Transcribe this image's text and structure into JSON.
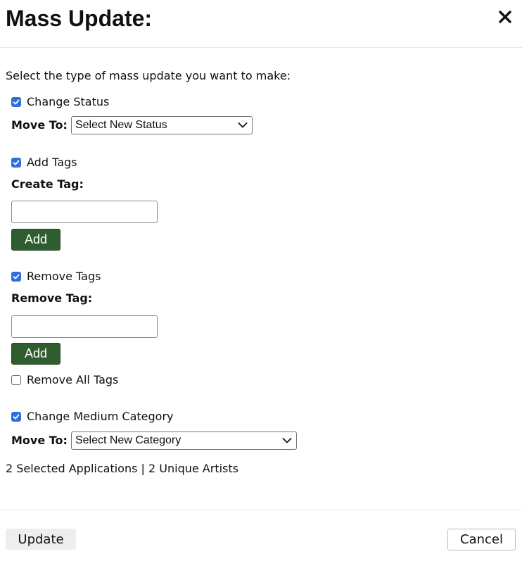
{
  "dialog": {
    "title": "Mass Update:",
    "close_icon": "close-icon",
    "intro": "Select the type of mass update you want to make:"
  },
  "change_status": {
    "checked": true,
    "label": "Change Status",
    "move_to_label": "Move To:",
    "select_value": "Select New Status"
  },
  "add_tags": {
    "checked": true,
    "label": "Add Tags",
    "field_label": "Create Tag:",
    "input_value": "",
    "button_label": "Add"
  },
  "remove_tags": {
    "checked": true,
    "label": "Remove Tags",
    "field_label": "Remove Tag:",
    "input_value": "",
    "button_label": "Add",
    "remove_all_checked": false,
    "remove_all_label": "Remove All Tags"
  },
  "change_medium": {
    "checked": true,
    "label": "Change Medium Category",
    "move_to_label": "Move To:",
    "select_value": "Select New Category"
  },
  "summary": "2 Selected Applications | 2 Unique Artists",
  "footer": {
    "update_label": "Update",
    "cancel_label": "Cancel"
  },
  "colors": {
    "checkbox_accent": "#2f6fdb",
    "add_button": "#2f5d2f"
  }
}
